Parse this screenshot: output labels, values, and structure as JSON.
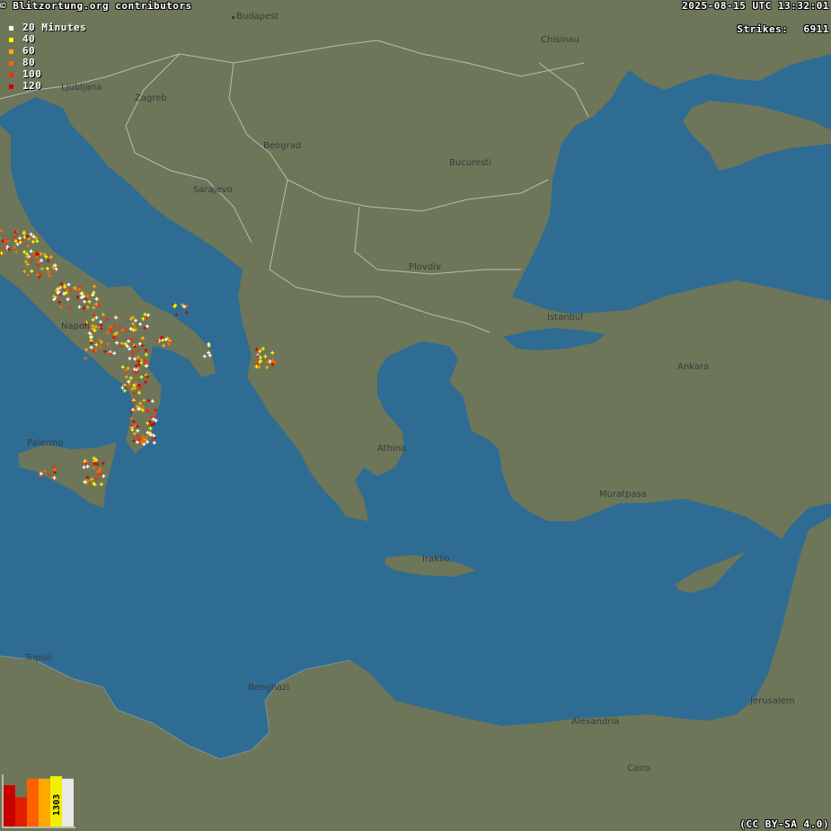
{
  "header": {
    "attribution": "© Blitzortung.org contributors",
    "timestamp": "2025-08-15 UTC 13:32:01",
    "strikes_label": "Strikes:",
    "strikes_value": "6911"
  },
  "footer": {
    "license": "(CC BY-SA 4.0)"
  },
  "legend": {
    "items": [
      {
        "label": "20 Minutes",
        "color": "#ffffff"
      },
      {
        "label": "40",
        "color": "#ffff00"
      },
      {
        "label": "60",
        "color": "#ffb000"
      },
      {
        "label": "80",
        "color": "#ff6a00"
      },
      {
        "label": "100",
        "color": "#ff2a00"
      },
      {
        "label": "120",
        "color": "#d10000"
      }
    ]
  },
  "histogram": {
    "label": "1303",
    "values": [
      0.82,
      0.58,
      0.95,
      0.95,
      1.0,
      0.95
    ],
    "colors": [
      "#c80000",
      "#e01e00",
      "#ff6000",
      "#ffa800",
      "#f0f000",
      "#e8e8e8"
    ]
  },
  "cities": [
    {
      "name": "Budapest"
    },
    {
      "name": "Chisinau"
    },
    {
      "name": "Ljubljana"
    },
    {
      "name": "Zagreb"
    },
    {
      "name": "Beograd"
    },
    {
      "name": "Bucuresti"
    },
    {
      "name": "Sarajevo"
    },
    {
      "name": "Plovdiv"
    },
    {
      "name": "Istanbul"
    },
    {
      "name": "Ankara"
    },
    {
      "name": "Napoli"
    },
    {
      "name": "Palermo"
    },
    {
      "name": "Athina"
    },
    {
      "name": "Muratpasa"
    },
    {
      "name": "Iraklio"
    },
    {
      "name": "Tripoli"
    },
    {
      "name": "Benghazi"
    },
    {
      "name": "Alexandria"
    },
    {
      "name": "Jerusalem"
    },
    {
      "name": "Cairo"
    }
  ],
  "colors": {
    "sea": "#2f6c93",
    "land": "#6d7659",
    "border": "#b9b9b9"
  }
}
